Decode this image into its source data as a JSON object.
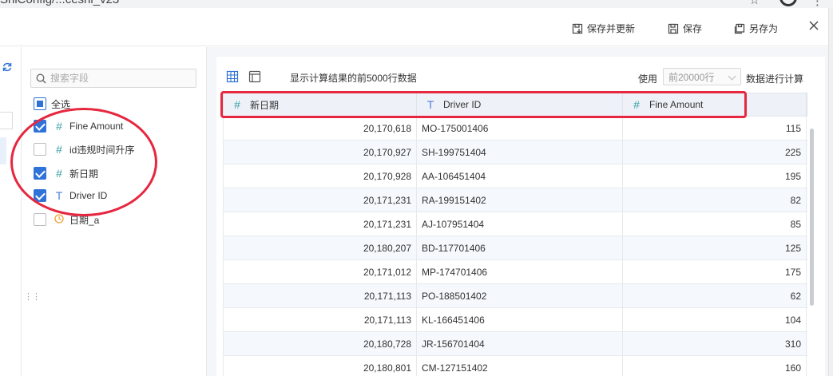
{
  "browser": {
    "url_fragment": "ShiConfig/...ceshi_v23"
  },
  "toolbar": {
    "save_update_label": "保存并更新",
    "save_label": "保存",
    "save_as_label": "另存为"
  },
  "fields": {
    "search_placeholder": "搜索字段",
    "select_all_label": "全选",
    "items": [
      {
        "label": "Fine Amount",
        "type": "number",
        "icon": "#",
        "checked": true
      },
      {
        "label": "id违规时间升序",
        "type": "number",
        "icon": "#",
        "checked": false
      },
      {
        "label": "新日期",
        "type": "number",
        "icon": "#",
        "checked": true
      },
      {
        "label": "Driver ID",
        "type": "text",
        "icon": "T",
        "checked": true
      },
      {
        "label": "日期_a",
        "type": "date",
        "icon": "clock",
        "checked": false
      }
    ]
  },
  "data": {
    "info": "显示计算结果的前5000行数据",
    "use_label": "使用",
    "rows_placeholder": "前20000行",
    "calc_label": "数据进行计算",
    "columns": [
      {
        "label": "新日期",
        "icon": "#"
      },
      {
        "label": "Driver ID",
        "icon": "T"
      },
      {
        "label": "Fine Amount",
        "icon": "#"
      }
    ],
    "rows": [
      [
        "20,170,618",
        "MO-175001406",
        "115"
      ],
      [
        "20,170,927",
        "SH-199751404",
        "225"
      ],
      [
        "20,170,928",
        "AA-106451404",
        "195"
      ],
      [
        "20,171,231",
        "RA-199151402",
        "82"
      ],
      [
        "20,171,231",
        "AJ-107951404",
        "85"
      ],
      [
        "20,180,207",
        "BD-117701406",
        "125"
      ],
      [
        "20,171,012",
        "MP-174701406",
        "175"
      ],
      [
        "20,171,113",
        "PO-188501402",
        "62"
      ],
      [
        "20,171,113",
        "KL-166451406",
        "104"
      ],
      [
        "20,180,728",
        "JR-156701404",
        "310"
      ],
      [
        "20,180,801",
        "CM-127151402",
        "160"
      ]
    ]
  },
  "colors": {
    "accent": "#2f72d8",
    "annotation": "#e6273f",
    "number_icon": "#3aa0a8"
  }
}
